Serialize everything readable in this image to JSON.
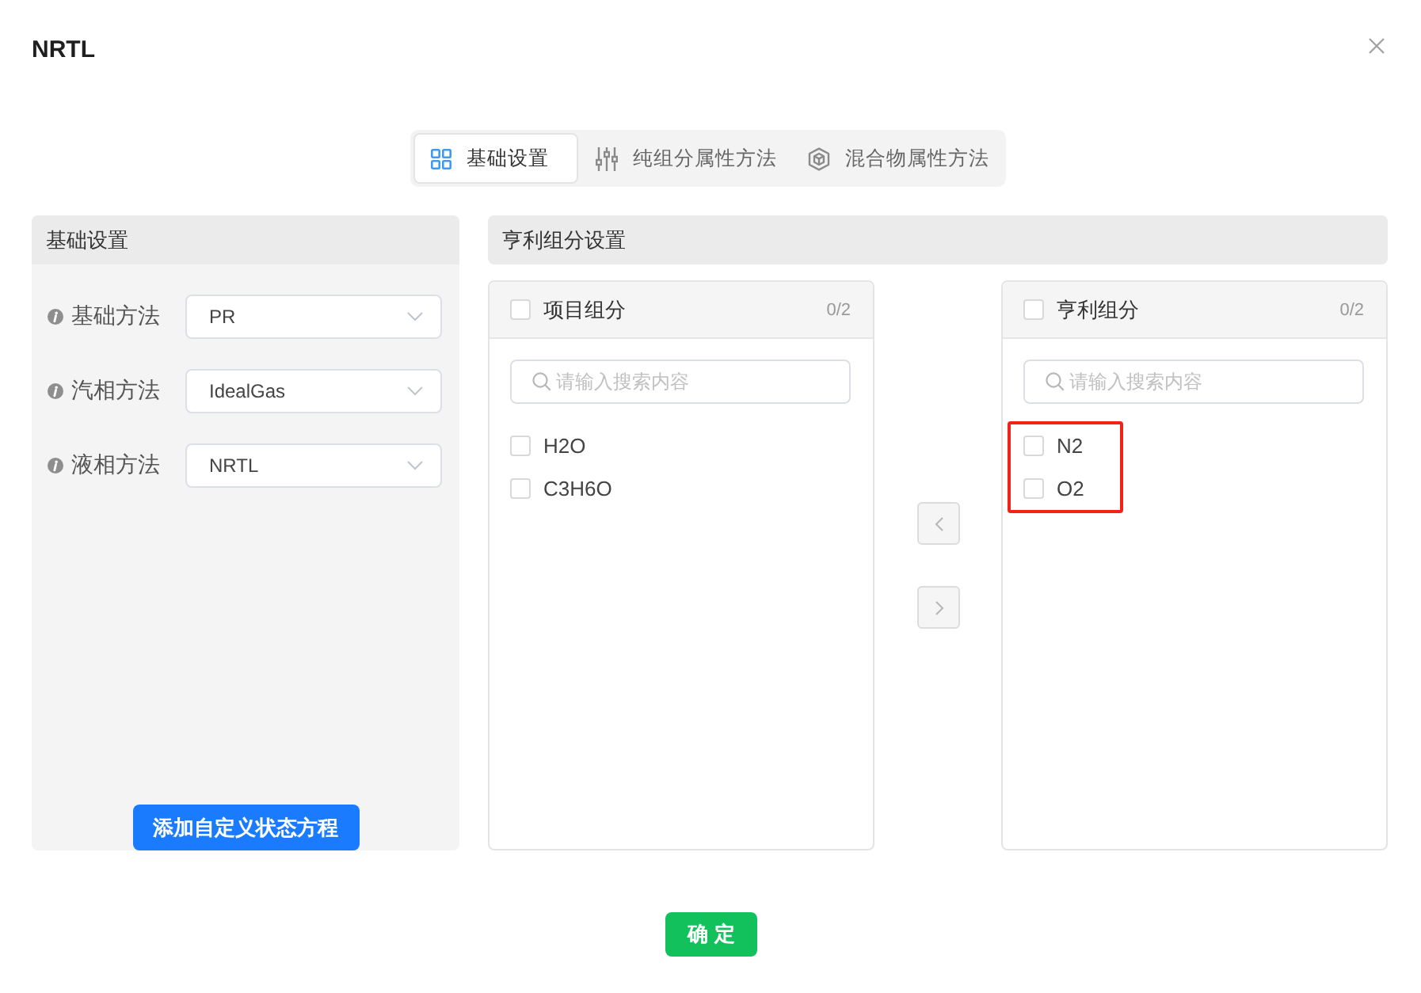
{
  "dialog": {
    "title": "NRTL"
  },
  "tabs": [
    {
      "label": "基础设置",
      "selected": true
    },
    {
      "label": "纯组分属性方法",
      "selected": false
    },
    {
      "label": "混合物属性方法",
      "selected": false
    }
  ],
  "basic_settings": {
    "title": "基础设置",
    "fields": [
      {
        "label": "基础方法",
        "value": "PR"
      },
      {
        "label": "汽相方法",
        "value": "IdealGas"
      },
      {
        "label": "液相方法",
        "value": "NRTL"
      }
    ],
    "button": "添加自定义状态方程"
  },
  "henry_settings": {
    "title": "亨利组分设置",
    "lists": [
      {
        "title": "项目组分",
        "checked": false,
        "count": "0/2",
        "placeholder": "请输入搜索内容",
        "items": [
          {
            "label": "H2O",
            "checked": false,
            "highlighted": false
          },
          {
            "label": "C3H6O",
            "checked": false,
            "highlighted": false
          }
        ]
      },
      {
        "title": "亨利组分",
        "checked": false,
        "count": "0/2",
        "placeholder": "请输入搜索内容",
        "items": [
          {
            "label": "N2",
            "checked": false,
            "highlighted": true
          },
          {
            "label": "O2",
            "checked": false,
            "highlighted": true
          }
        ]
      }
    ],
    "transfer_buttons": [
      {
        "disabled": true
      },
      {
        "disabled": true
      }
    ]
  },
  "confirm_button": "确 定"
}
